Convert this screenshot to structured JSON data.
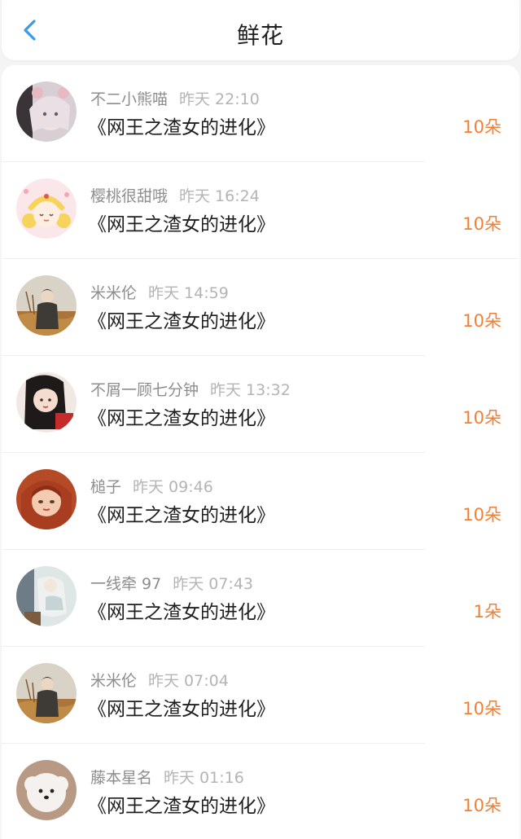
{
  "header": {
    "title": "鲜花",
    "back_icon": "chevron-left-icon",
    "back_color": "#3a9be8"
  },
  "accent_color": "#f37f32",
  "items": [
    {
      "user": "不二小熊喵",
      "time": "昨天 22:10",
      "book": "《网王之渣女的进化》",
      "count": "10朵"
    },
    {
      "user": "樱桃很甜哦",
      "time": "昨天 16:24",
      "book": "《网王之渣女的进化》",
      "count": "10朵"
    },
    {
      "user": "米米伦",
      "time": "昨天 14:59",
      "book": "《网王之渣女的进化》",
      "count": "10朵"
    },
    {
      "user": "不屑一顾七分钟",
      "time": "昨天 13:32",
      "book": "《网王之渣女的进化》",
      "count": "10朵"
    },
    {
      "user": "槌子",
      "time": "昨天 09:46",
      "book": "《网王之渣女的进化》",
      "count": "10朵"
    },
    {
      "user": "一线牵 97",
      "time": "昨天 07:43",
      "book": "《网王之渣女的进化》",
      "count": "1朵"
    },
    {
      "user": "米米伦",
      "time": "昨天 07:04",
      "book": "《网王之渣女的进化》",
      "count": "10朵"
    },
    {
      "user": "藤本星名",
      "time": "昨天 01:16",
      "book": "《网王之渣女的进化》",
      "count": "10朵"
    }
  ]
}
